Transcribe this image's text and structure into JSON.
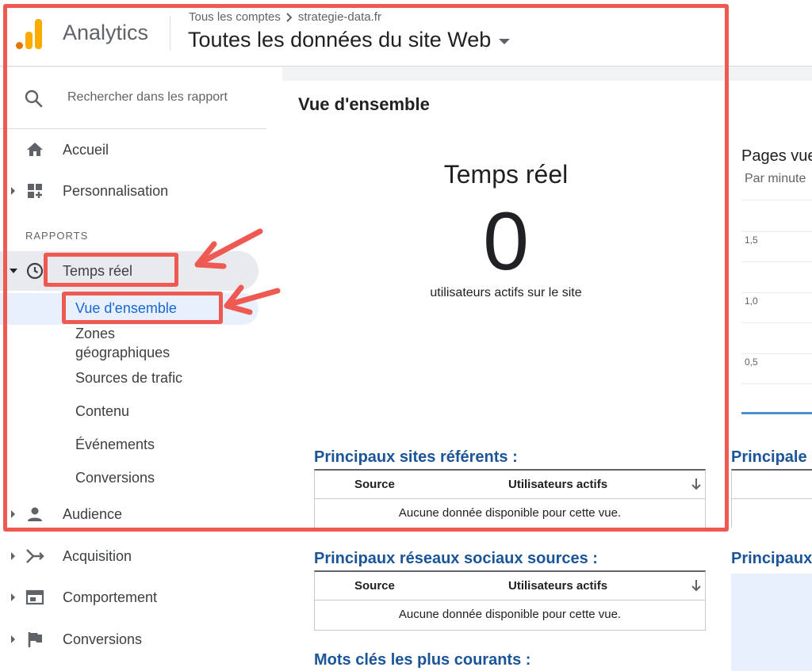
{
  "header": {
    "app_name": "Analytics",
    "breadcrumb_account": "Tous les comptes",
    "breadcrumb_property": "strategie-data.fr",
    "view_title": "Toutes les données du site Web"
  },
  "sidebar": {
    "search_placeholder": "Rechercher dans les rapport",
    "home": "Accueil",
    "customization": "Personnalisation",
    "section_label": "RAPPORTS",
    "realtime": "Temps réel",
    "realtime_sub": {
      "overview": "Vue d'ensemble",
      "locations": "Zones géographiques",
      "traffic_sources": "Sources de trafic",
      "content": "Contenu",
      "events": "Événements",
      "conversions": "Conversions"
    },
    "audience": "Audience",
    "acquisition": "Acquisition",
    "behavior": "Comportement",
    "conversions": "Conversions"
  },
  "main": {
    "overview_title": "Vue d'ensemble",
    "realtime_title": "Temps réel",
    "active_count": "0",
    "active_desc": "utilisateurs actifs sur le site",
    "referrers_title": "Principaux sites référents :",
    "social_title": "Principaux réseaux sociaux sources :",
    "keywords_title": "Mots clés les plus courants :",
    "col_source": "Source",
    "col_active_users": "Utilisateurs actifs",
    "no_data": "Aucune donnée disponible pour cette vue."
  },
  "right_panel": {
    "title": "Pages vue",
    "subtitle": "Par minute",
    "ticks": [
      "1,5",
      "1,0",
      "0,5"
    ],
    "section_1": "Principale",
    "section_2": "Principaux"
  },
  "colors": {
    "accent_blue": "#1967d2",
    "section_title_blue": "#1a5499",
    "annotation_red": "#ee5a52",
    "logo_orange": "#f9ab00"
  }
}
